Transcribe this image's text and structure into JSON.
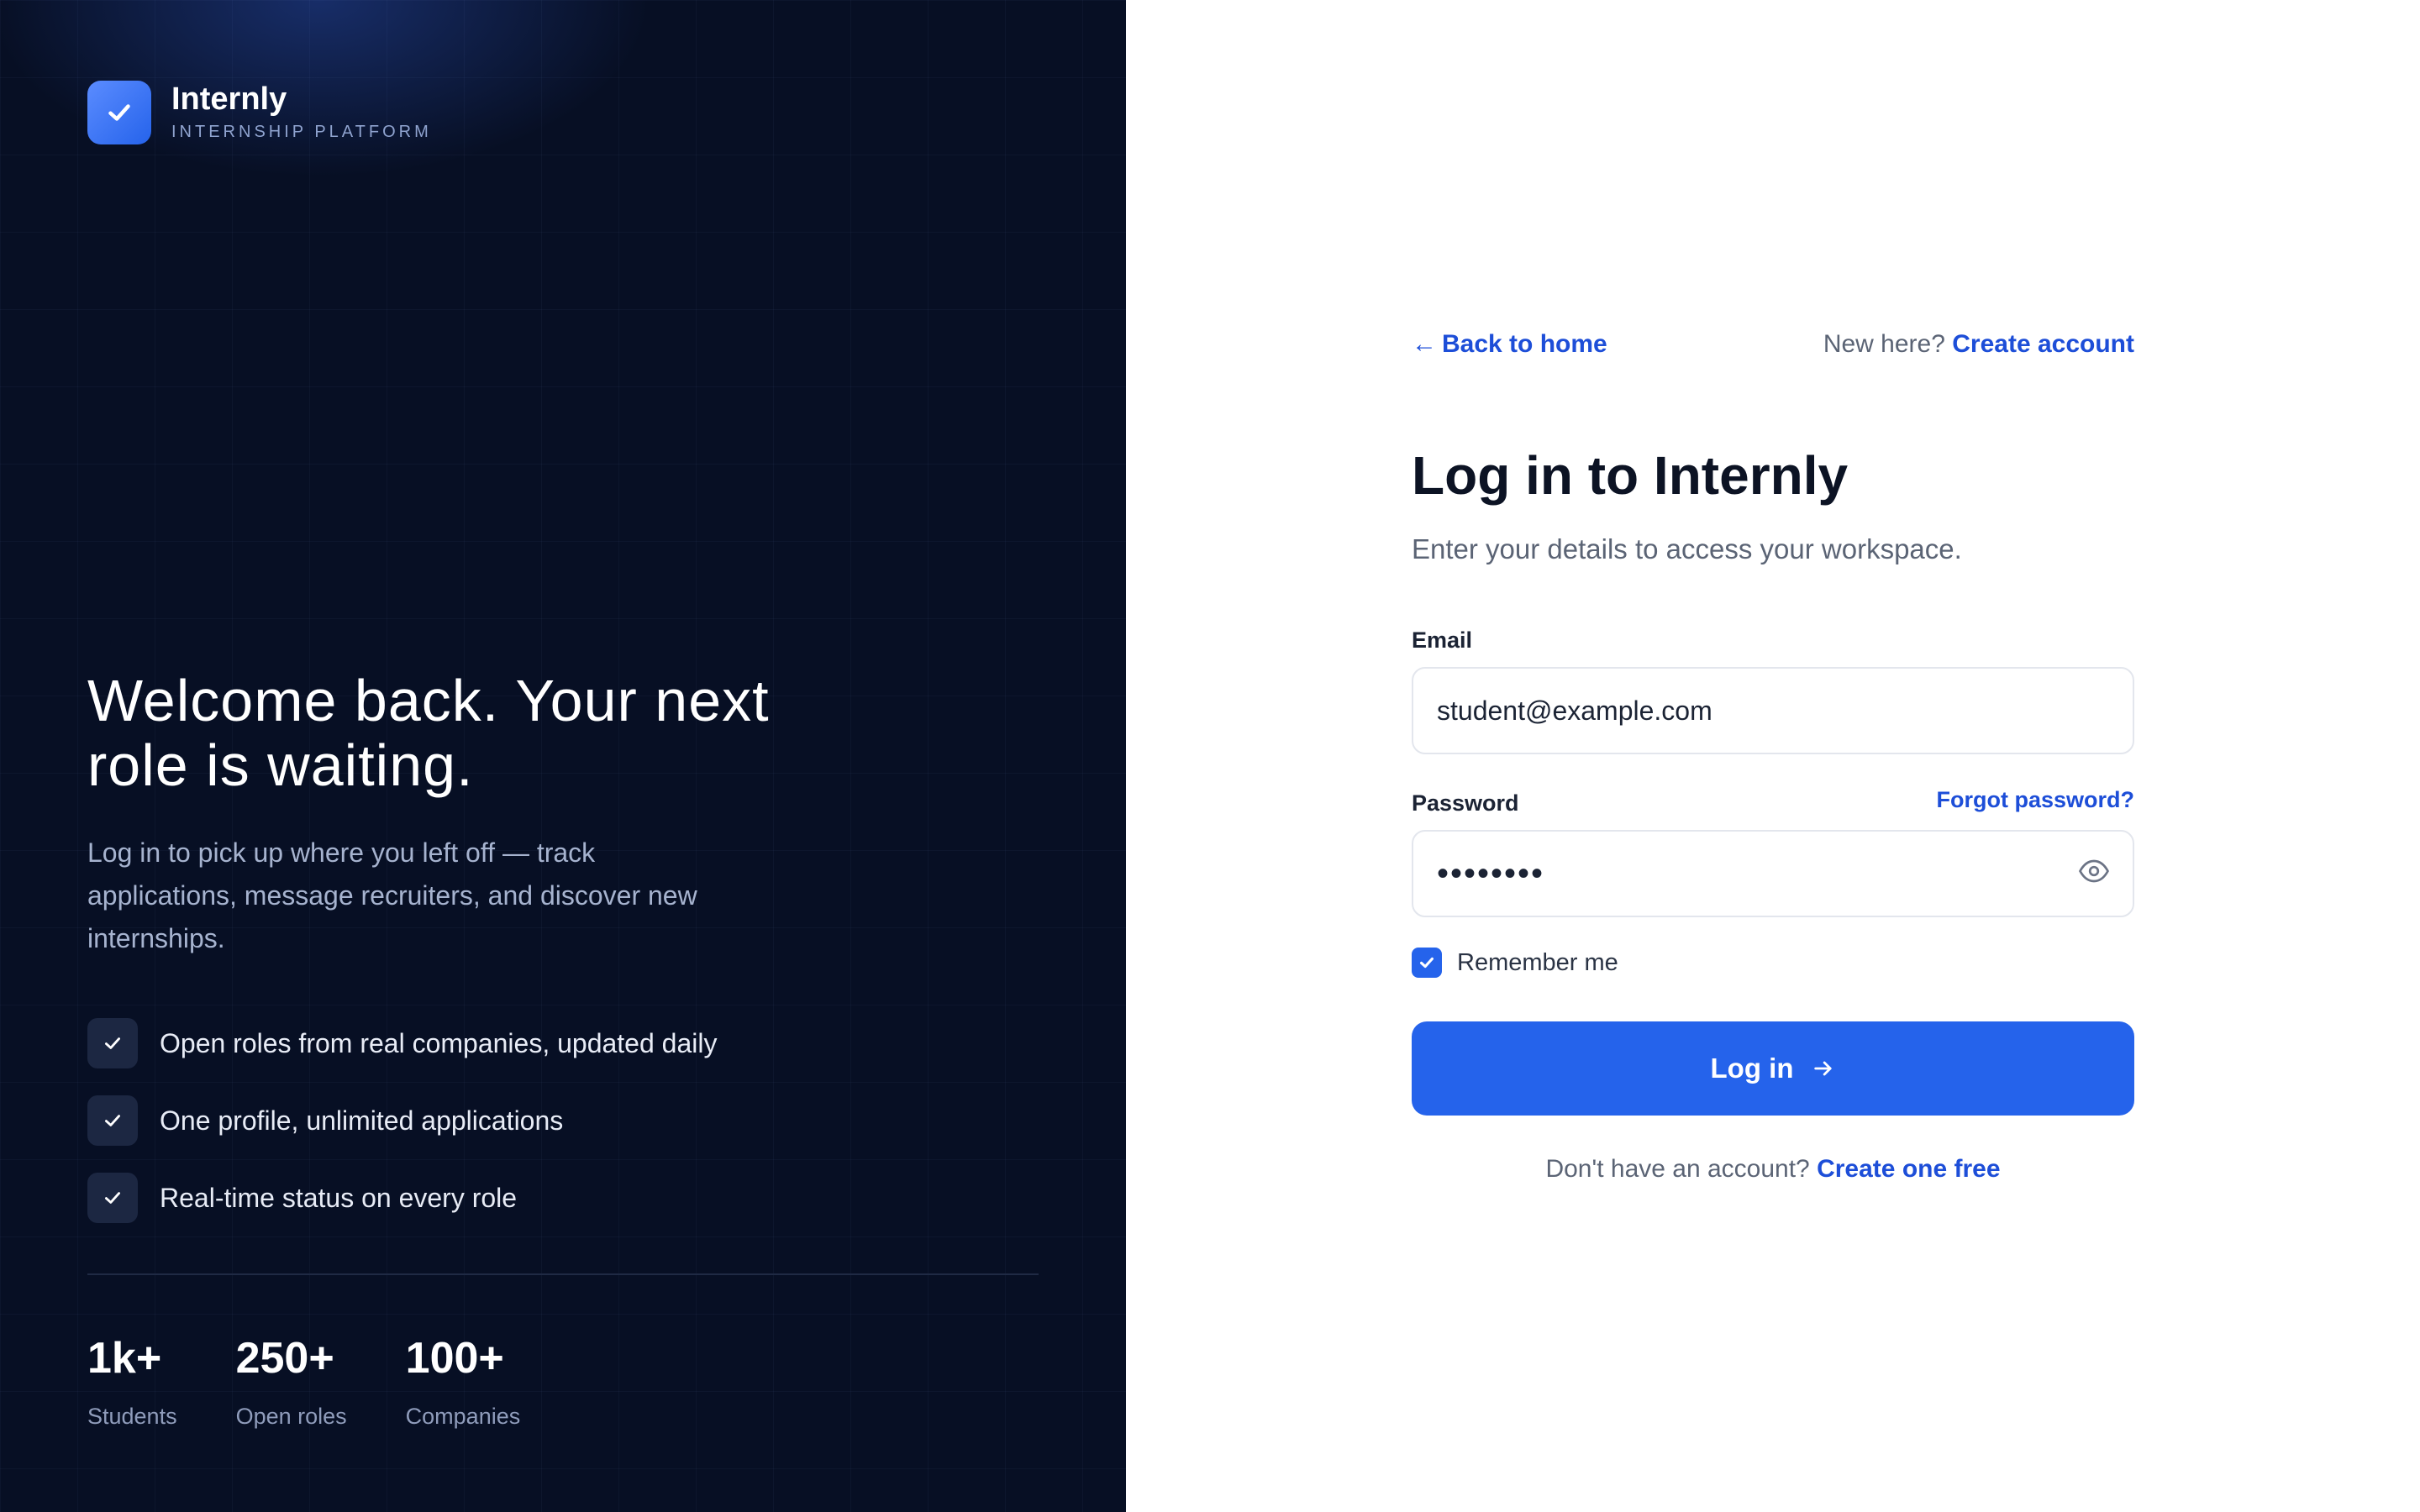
{
  "brand": {
    "name": "Internly",
    "tagline": "INTERNSHIP PLATFORM"
  },
  "hero": {
    "title": "Welcome back. Your next role is waiting.",
    "subtitle": "Log in to pick up where you left off — track applications, message recruiters, and discover new internships.",
    "features": [
      {
        "label": "Open roles from real companies, updated daily"
      },
      {
        "label": "One profile, unlimited applications"
      },
      {
        "label": "Real-time status on every role"
      }
    ],
    "stats": [
      {
        "value": "1k+",
        "label": "Students"
      },
      {
        "value": "250+",
        "label": "Open roles"
      },
      {
        "value": "100+",
        "label": "Companies"
      }
    ]
  },
  "nav": {
    "back_label": "Back to home",
    "new_here_label": "New here?",
    "create_account_label": "Create account"
  },
  "form": {
    "title": "Log in to Internly",
    "subtitle": "Enter your details to access your workspace.",
    "email_label": "Email",
    "email_value": "student@example.com",
    "password_label": "Password",
    "password_value": "password",
    "forgot_label": "Forgot password?",
    "remember_label": "Remember me",
    "remember_checked": true,
    "submit_label": "Log in",
    "no_account_label": "Don't have an account?",
    "create_free_label": "Create one free"
  },
  "colors": {
    "accent": "#2563eb",
    "link": "#1d4ed8",
    "hero_bg": "#070f24"
  },
  "icons": {
    "logo": "check-icon",
    "back": "arrow-left-icon",
    "feature": "check-icon",
    "password_toggle": "eye-icon",
    "submit": "arrow-right-icon"
  }
}
